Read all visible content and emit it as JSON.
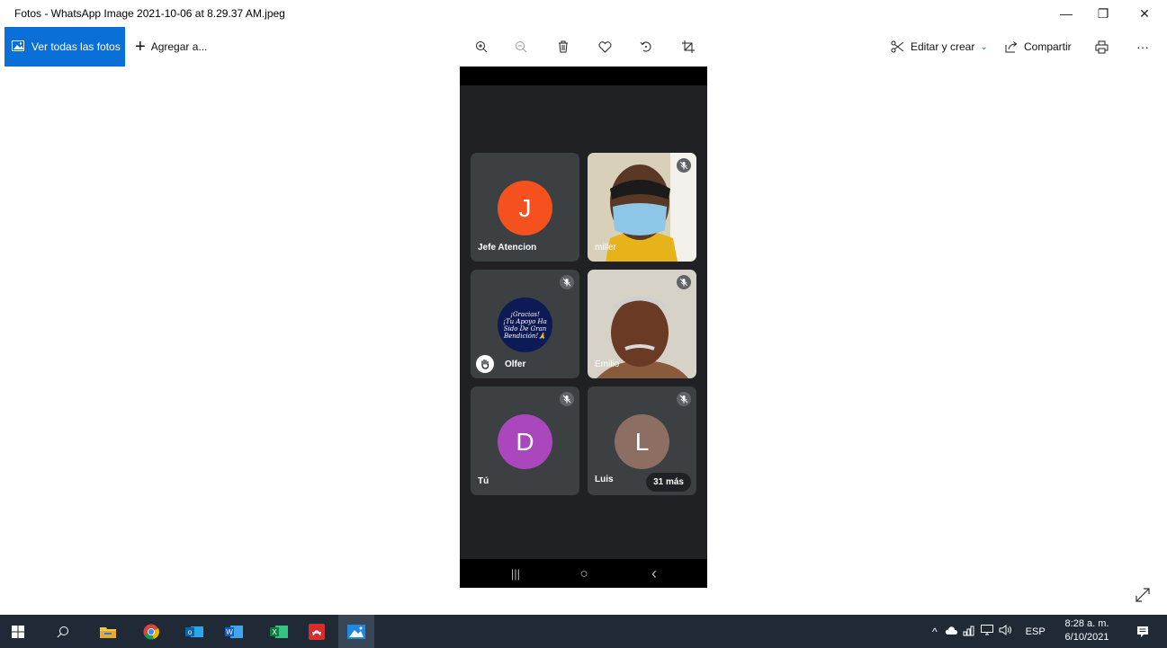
{
  "window": {
    "title": "Fotos - WhatsApp Image 2021-10-06 at 8.29.37 AM.jpeg",
    "minimize": "—",
    "restore": "❐",
    "close": "✕"
  },
  "toolbar": {
    "see_all": "Ver todas las fotos",
    "add_to": "Agregar a...",
    "edit_create": "Editar y crear",
    "share": "Compartir",
    "more": "···"
  },
  "meet": {
    "tiles": [
      {
        "name": "Jefe Atencion",
        "initial": "J",
        "color": "#f4511e",
        "muted": false
      },
      {
        "name": "miller",
        "initial": "",
        "color": "",
        "muted": true
      },
      {
        "name": "Olfer",
        "initial": "",
        "color": "",
        "muted": true,
        "hand_raised": true,
        "avatar_text": "¡Gracias!\n¡Tu Apoyo Ha\nSido De Gran\nBendición!🙏"
      },
      {
        "name": "Emilio",
        "initial": "",
        "color": "",
        "muted": true
      },
      {
        "name": "Tú",
        "initial": "D",
        "color": "#ab47bc",
        "muted": true
      },
      {
        "name": "Luis",
        "initial": "L",
        "color": "#8d6e63",
        "muted": true,
        "more_badge": "31 más"
      }
    ],
    "nav": {
      "recent": "|||",
      "home": "○",
      "back": "‹"
    }
  },
  "taskbar": {
    "language": "ESP",
    "time": "8:28 a. m.",
    "date": "6/10/2021"
  }
}
